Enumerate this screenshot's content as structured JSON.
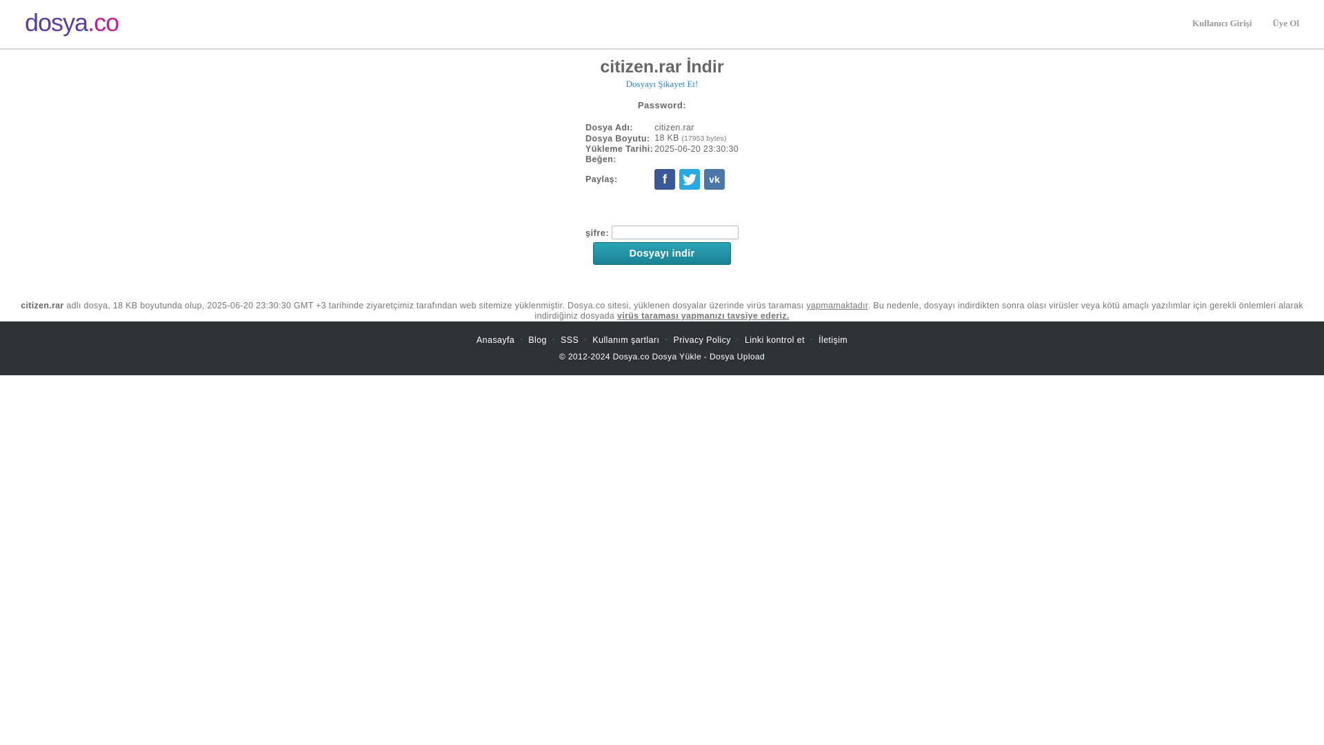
{
  "header": {
    "logo_part1": "dosya",
    "logo_part2": ".co",
    "login": "Kullanıcı Girişi",
    "register": "Üye Ol"
  },
  "main": {
    "title": "citizen.rar İndir",
    "report": "Dosyayı Şikayet Et!",
    "password_label": "Password:"
  },
  "info": {
    "name_label": "Dosya Adı:",
    "name_value": "citizen.rar",
    "size_label": "Dosya Boyutu:",
    "size_value": "18 KB",
    "size_bytes": "(17953 bytes)",
    "date_label": "Yükleme Tarihi:",
    "date_value": "2025-06-20 23:30:30",
    "like_label": "Beğen:",
    "share_label": "Paylaş:",
    "share_icons": [
      "facebook-icon",
      "twitter-icon",
      "vk-icon"
    ],
    "share_colors": {
      "facebook": "#3b5998",
      "twitter": "#29a9e1",
      "vk": "#4a76a8"
    }
  },
  "form": {
    "password_field_label": "şifre:",
    "password_value": "",
    "download_button": "Dosyayı indir",
    "button_color": "#1f8fa2"
  },
  "notice": {
    "filename": "citizen.rar",
    "text1": " adlı dosya, 18 KB boyutunda olup, 2025-06-20 23:30:30 GMT +3 tarihinde ziyaretçimiz tarafından web sitemize yüklenmiştir. Dosya.co sitesi, yüklenen dosyalar üzerinde virüs taraması ",
    "link1": "yapmamaktadır",
    "text2": ". Bu nedenle, dosyayı indirdikten sonra olası virüsler veya kötü amaçlı yazılımlar için gerekli önlemleri alarak indirdiğiniz dosyada ",
    "link2": "virüs taraması yapmanızı tavsiye ederiz."
  },
  "footer": {
    "links": [
      "Anasayfa",
      "Blog",
      "SSS",
      "Kullanım şartları",
      "Privacy Policy",
      "Linki kontrol et",
      "İletişim"
    ],
    "separator": "-",
    "copyright": "© 2012-2024 Dosya.co Dosya Yükle - Dosya Upload",
    "bg_color": "#2d3233"
  }
}
